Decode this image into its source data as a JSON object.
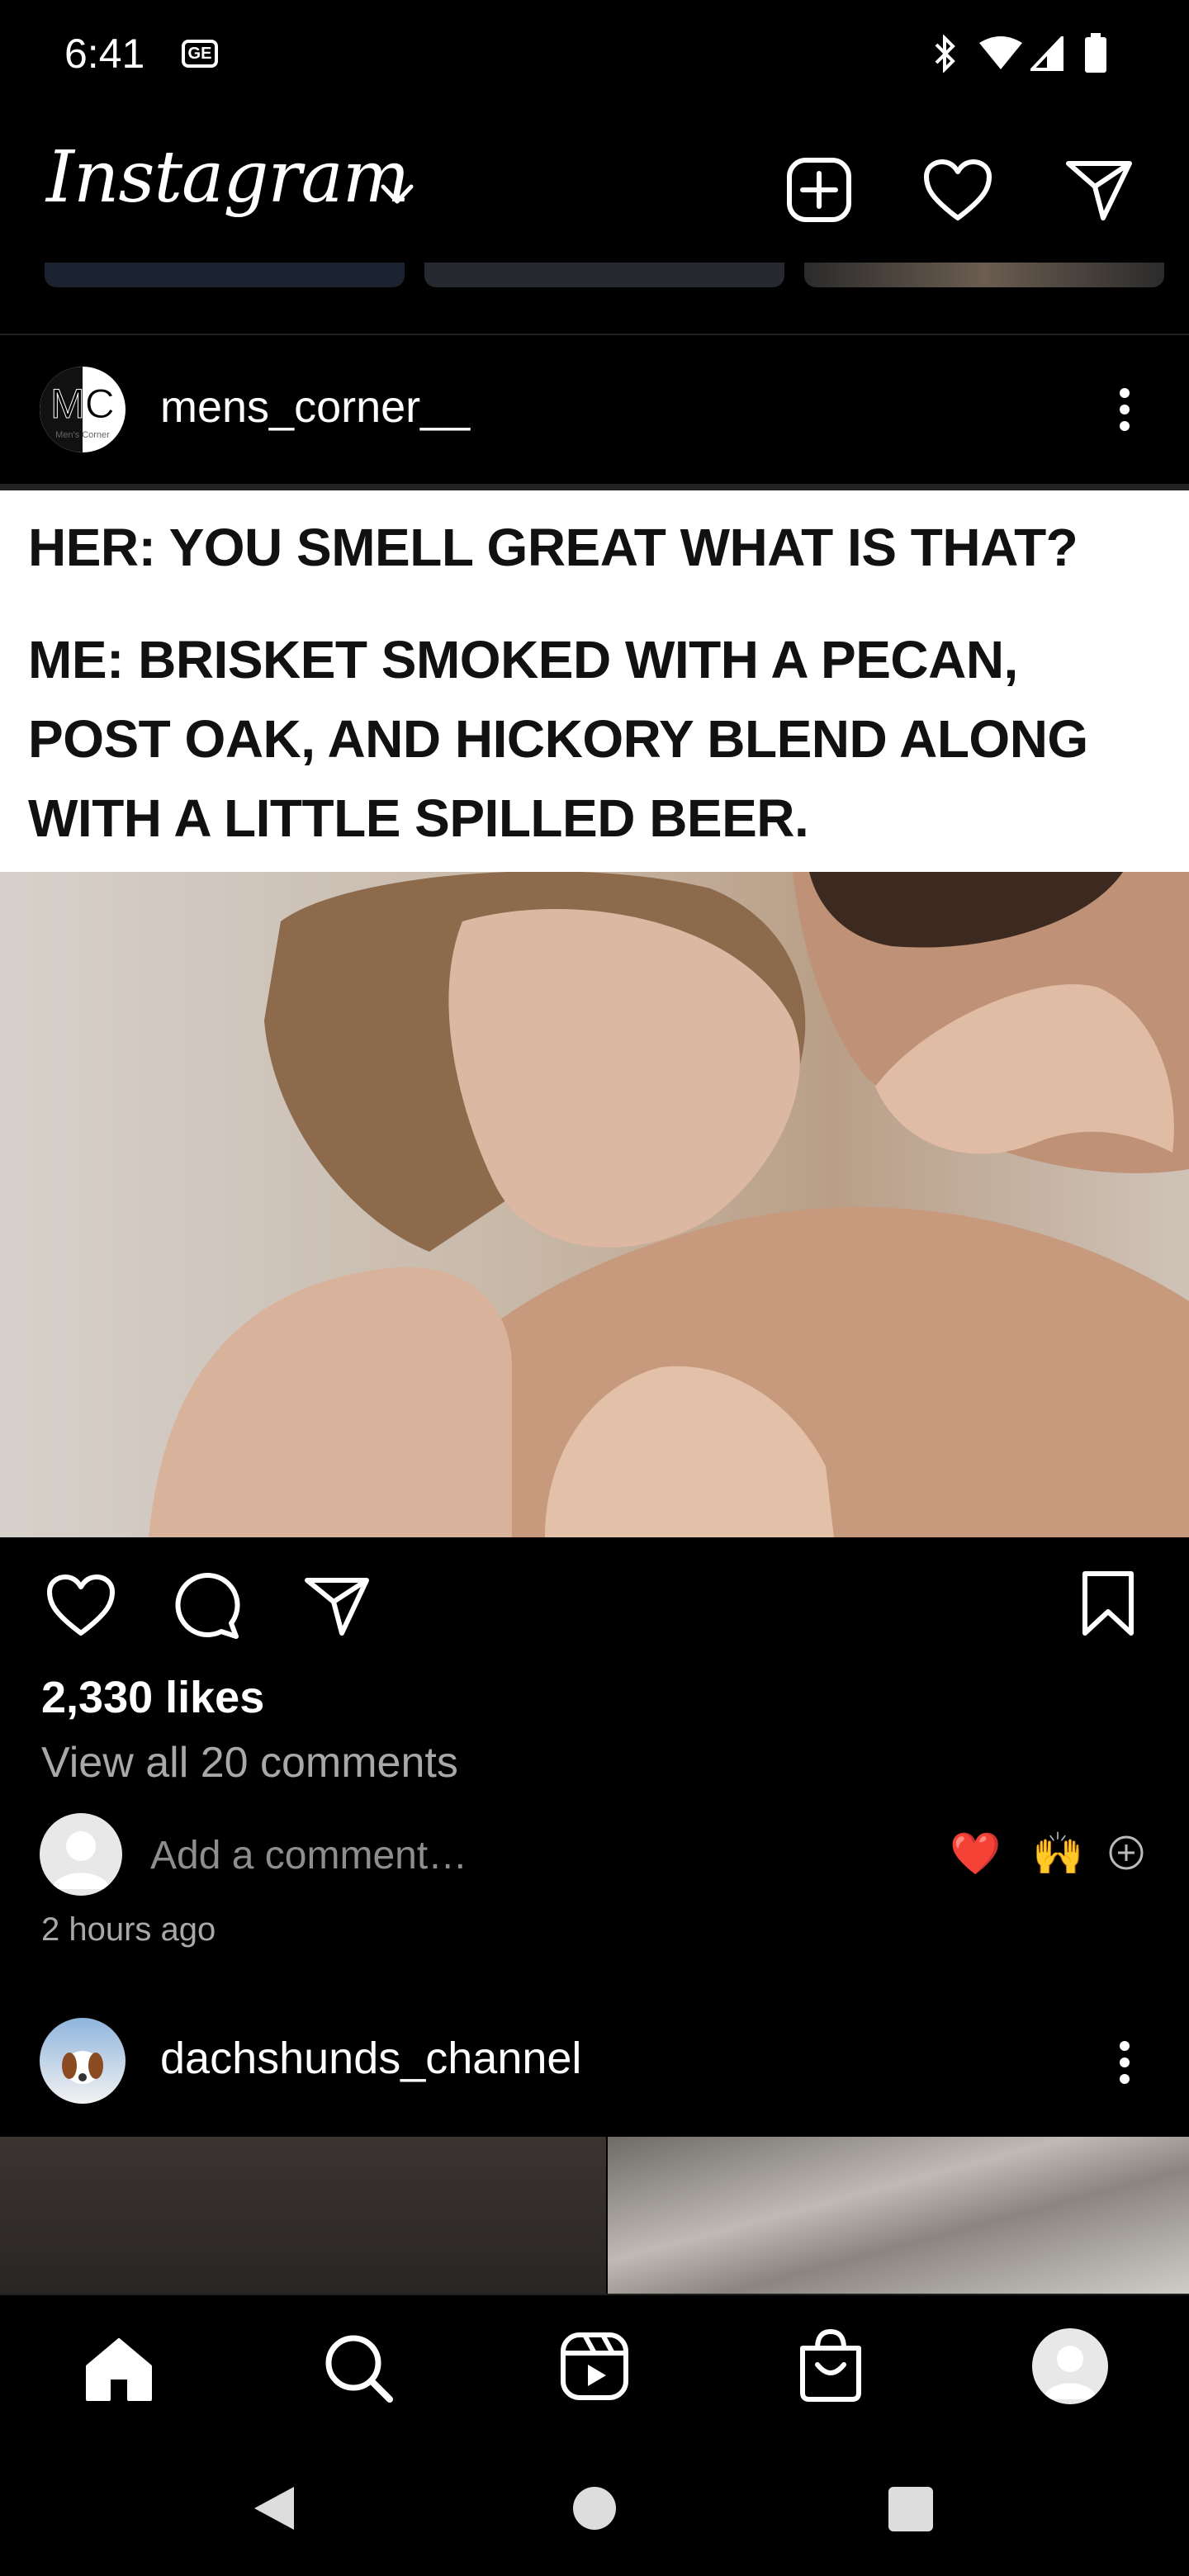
{
  "status_bar": {
    "time": "6:41",
    "notification_badge": "GE"
  },
  "header": {
    "app_name": "Instagram",
    "icons": [
      "chevron-down-icon",
      "new-post-icon",
      "heart-icon",
      "direct-message-icon"
    ]
  },
  "post1": {
    "username": "mens_corner__",
    "avatar_text": "MC",
    "avatar_subtext": "Men's Corner",
    "meme_lines": [
      "HER: YOU SMELL GREAT WHAT IS THAT?",
      "ME: BRISKET SMOKED WITH A PECAN,",
      "POST OAK, AND HICKORY BLEND ALONG",
      "WITH A LITTLE SPILLED BEER."
    ],
    "likes": "2,330 likes",
    "view_comments": "View all 20 comments",
    "comment_placeholder": "Add a comment…",
    "quick_emojis": [
      "❤️",
      "🙌"
    ],
    "time_ago": "2 hours ago"
  },
  "post2": {
    "username": "dachshunds_channel"
  },
  "bottom_nav": {
    "items": [
      "home-icon",
      "search-icon",
      "reels-icon",
      "shop-icon",
      "profile-icon"
    ]
  },
  "colors": {
    "background": "#000000",
    "text": "#ffffff",
    "secondary_text": "#a8a8a8",
    "heart_red": "#ed4956"
  }
}
